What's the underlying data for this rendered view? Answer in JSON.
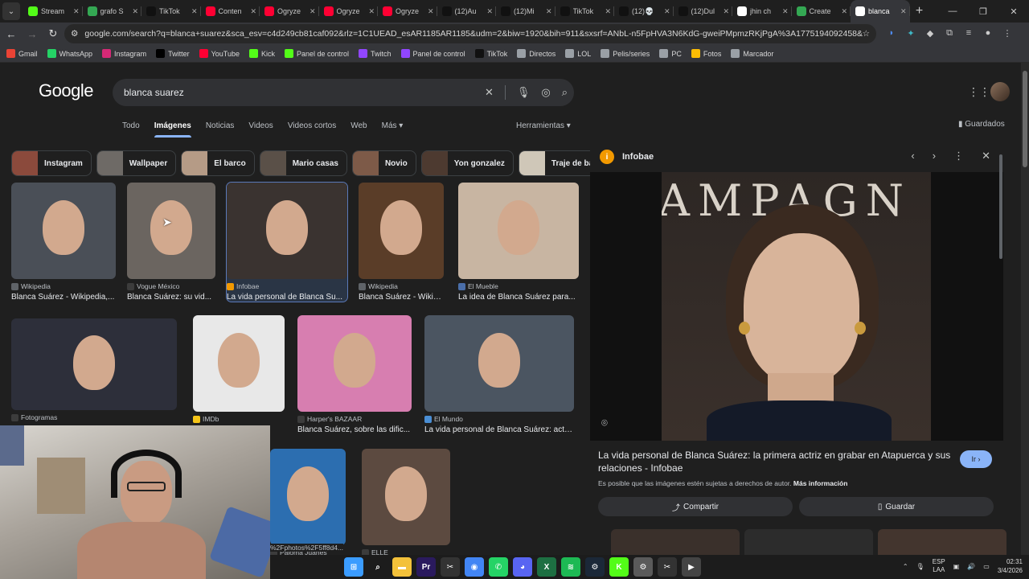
{
  "tabs": [
    {
      "label": "Stream",
      "favicon": "kick-icon",
      "color": "#53fc18"
    },
    {
      "label": "grafo S",
      "favicon": "sheets-icon",
      "color": "#34a853"
    },
    {
      "label": "TikTok",
      "favicon": "tiktok-icon",
      "color": "#111111"
    },
    {
      "label": "Conten",
      "favicon": "youtube-icon",
      "color": "#ff0033"
    },
    {
      "label": "Ogryze",
      "favicon": "youtube-icon",
      "color": "#ff0033"
    },
    {
      "label": "Ogryze",
      "favicon": "youtube-icon",
      "color": "#ff0033"
    },
    {
      "label": "Ogryze",
      "favicon": "youtube-icon",
      "color": "#ff0033"
    },
    {
      "label": "(12)Au",
      "favicon": "tiktok-icon",
      "color": "#111111"
    },
    {
      "label": "(12)Mi",
      "favicon": "tiktok-icon",
      "color": "#111111"
    },
    {
      "label": "TikTok",
      "favicon": "tiktok-icon",
      "color": "#111111"
    },
    {
      "label": "(12)💀",
      "favicon": "tiktok-icon",
      "color": "#111111"
    },
    {
      "label": "(12)Dul",
      "favicon": "tiktok-icon",
      "color": "#111111"
    },
    {
      "label": "jhin ch",
      "favicon": "google-icon",
      "color": "#ffffff"
    },
    {
      "label": "Create",
      "favicon": "sheets-icon",
      "color": "#34a853"
    },
    {
      "label": "blanca",
      "favicon": "google-icon",
      "color": "#ffffff",
      "active": true
    }
  ],
  "address": {
    "url": "google.com/search?q=blanca+suarez&sca_esv=c4d249cb81caf092&rlz=1C1UEAD_esAR1185AR1185&udm=2&biw=1920&bih=911&sxsrf=ANbL-n5FpHVA3N6KdG-gweiPMpmzRKjPgA%3A1775194092458&ei=7E_PaYjRG8yI5OUPz..."
  },
  "bookmarks": [
    {
      "label": "Gmail",
      "icon": "gmail-icon",
      "color": "#ea4335"
    },
    {
      "label": "WhatsApp",
      "icon": "whatsapp-icon",
      "color": "#25d366"
    },
    {
      "label": "Instagram",
      "icon": "instagram-icon",
      "color": "#d62976"
    },
    {
      "label": "Twitter",
      "icon": "x-icon",
      "color": "#000000"
    },
    {
      "label": "YouTube",
      "icon": "youtube-icon",
      "color": "#ff0033"
    },
    {
      "label": "Kick",
      "icon": "kick-icon",
      "color": "#53fc18"
    },
    {
      "label": "Panel de control",
      "icon": "kick-icon",
      "color": "#53fc18"
    },
    {
      "label": "Twitch",
      "icon": "twitch-icon",
      "color": "#9146ff"
    },
    {
      "label": "Panel de control",
      "icon": "twitch-icon",
      "color": "#9146ff"
    },
    {
      "label": "TikTok",
      "icon": "tiktok-icon",
      "color": "#111111"
    },
    {
      "label": "Directos",
      "icon": "folder-icon",
      "color": "#9aa0a6"
    },
    {
      "label": "LOL",
      "icon": "folder-icon",
      "color": "#9aa0a6"
    },
    {
      "label": "Pelis/series",
      "icon": "folder-icon",
      "color": "#9aa0a6"
    },
    {
      "label": "PC",
      "icon": "folder-icon",
      "color": "#9aa0a6"
    },
    {
      "label": "Fotos",
      "icon": "photos-icon",
      "color": "#fbbc04"
    },
    {
      "label": "Marcador",
      "icon": "globe-icon",
      "color": "#9aa0a6"
    }
  ],
  "google": {
    "logo": "Google",
    "query": "blanca suarez",
    "nav_tabs": [
      "Todo",
      "Imágenes",
      "Noticias",
      "Videos",
      "Videos cortos",
      "Web",
      "Más ▾"
    ],
    "tools": "Herramientas ▾",
    "saved": "Guardados",
    "chips": [
      "Instagram",
      "Wallpaper",
      "El barco",
      "Mario casas",
      "Novio",
      "Yon gonzalez",
      "Traje de baño"
    ]
  },
  "results": [
    {
      "source": "Wikipedia",
      "title": "Blanca Suárez - Wikipedia,...",
      "icon_color": "#5f6368"
    },
    {
      "source": "Vogue México",
      "title": "Blanca Suárez: su vid...",
      "icon_color": "#3c3c3c"
    },
    {
      "source": "Infobae",
      "title": "La vida personal de Blanca Su...",
      "icon_color": "#f29900"
    },
    {
      "source": "Wikipedia",
      "title": "Blanca Suárez - Wikip...",
      "icon_color": "#5f6368"
    },
    {
      "source": "El Mueble",
      "title": "La idea de Blanca Suárez para...",
      "icon_color": "#4a6ea9"
    },
    {
      "source": "Fotogramas",
      "title": "",
      "icon_color": "#3c3c3c"
    },
    {
      "source": "IMDb",
      "title": "",
      "icon_color": "#f5c518"
    },
    {
      "source": "Harper's BAZAAR",
      "title": "Blanca Suárez, sobre las dific...",
      "icon_color": "#3c3c3c"
    },
    {
      "source": "El Mundo",
      "title": "La vida personal de Blanca Suárez: actriz...",
      "icon_color": "#4a8ed4"
    },
    {
      "source": "Paloma Juanes",
      "title": "",
      "icon_color": "#3c3c3c"
    },
    {
      "source": "ELLE",
      "title": "",
      "icon_color": "#3c3c3c"
    }
  ],
  "panel": {
    "source": "Infobae",
    "title": "La vida personal de Blanca Suárez: la primera actriz en grabar en Atapuerca y sus relaciones - Infobae",
    "visit": "Ir",
    "legal": "Es posible que las imágenes estén sujetas a derechos de autor.",
    "legal_link": "Más información",
    "share": "Compartir",
    "save": "Guardar",
    "backdrop_text": "AMPAGN"
  },
  "tooltip": "%2Fphotos%2F5ff8d4...",
  "taskbar": {
    "lang": "ESP",
    "lang2": "LAA",
    "time": "02:31",
    "date": "3/4/2026",
    "apps": [
      {
        "icon": "windows-icon",
        "color": "#3b9cff"
      },
      {
        "icon": "search-icon",
        "color": "#1c1c1c"
      },
      {
        "icon": "folder-icon",
        "color": "#f3c13a"
      },
      {
        "icon": "premiere-icon",
        "color": "#2a1a5e"
      },
      {
        "icon": "capcut-icon",
        "color": "#333333"
      },
      {
        "icon": "chrome-icon",
        "color": "#4285f4"
      },
      {
        "icon": "whatsapp-icon",
        "color": "#25d366"
      },
      {
        "icon": "discord-icon",
        "color": "#5865f2"
      },
      {
        "icon": "excel-icon",
        "color": "#1d6f42"
      },
      {
        "icon": "spotify-icon",
        "color": "#1db954"
      },
      {
        "icon": "steam-icon",
        "color": "#1b2838"
      },
      {
        "icon": "kick-icon",
        "color": "#53fc18"
      },
      {
        "icon": "settings-icon",
        "color": "#5a5a5a"
      },
      {
        "icon": "capcut-icon",
        "color": "#333333"
      },
      {
        "icon": "media-player-icon",
        "color": "#444444"
      }
    ]
  }
}
